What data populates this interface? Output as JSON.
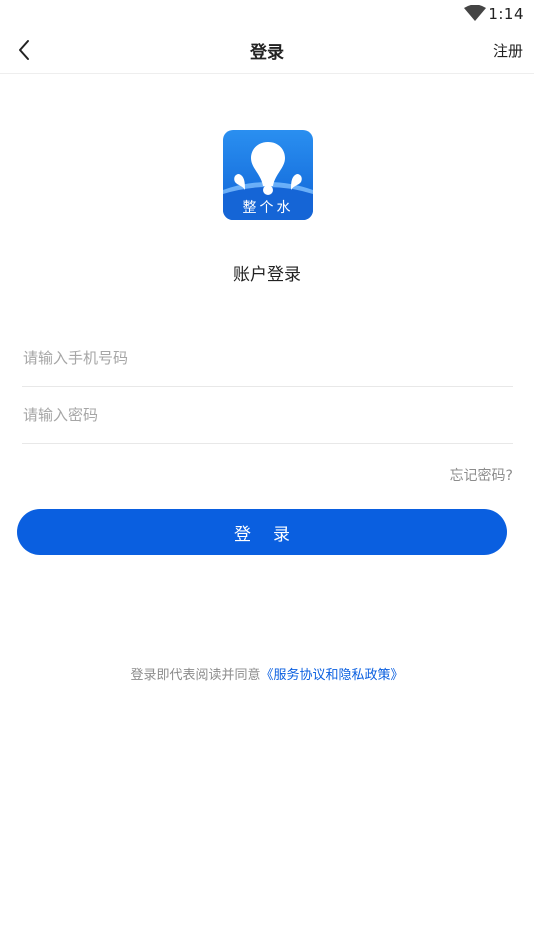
{
  "status_bar": {
    "time": "1:14",
    "wifi_icon": "wifi-icon"
  },
  "nav": {
    "back_icon": "chevron-left-icon",
    "title": "登录",
    "register_label": "注册"
  },
  "logo": {
    "text": "整个水",
    "colors": {
      "top": "#2a8ff0",
      "bottom": "#0f63d6"
    }
  },
  "subtitle": "账户登录",
  "form": {
    "phone_placeholder": "请输入手机号码",
    "phone_value": "",
    "password_placeholder": "请输入密码",
    "password_value": "",
    "forgot_label": "忘记密码?",
    "login_label": "登录"
  },
  "agreement": {
    "prefix": "登录即代表阅读并同意",
    "link": "《服务协议和隐私政策》"
  },
  "colors": {
    "accent": "#0a5fe0",
    "muted_text": "#8c8c8c",
    "placeholder": "#a6a6a6"
  }
}
